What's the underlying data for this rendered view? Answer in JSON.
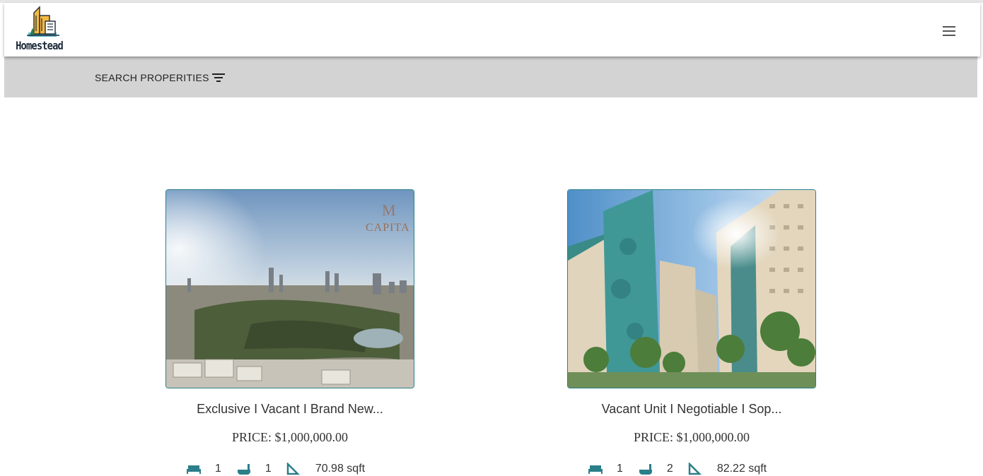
{
  "brand": {
    "name": "Homestead"
  },
  "header": {
    "menu_icon": "hamburger-icon"
  },
  "search": {
    "label": "SEARCH PROPERITIES",
    "icon": "filter-icon"
  },
  "colors": {
    "accent": "#2b7f8a",
    "searchbar_bg": "#d3d3d3"
  },
  "listings": [
    {
      "title": "Exclusive I Vacant I Brand New...",
      "price": "PRICE: $1,000,000.00",
      "beds": "1",
      "baths": "1",
      "area": "70.98 sqft",
      "watermark": "CAPITA"
    },
    {
      "title": "Vacant Unit I Negotiable I Sop...",
      "price": "PRICE: $1,000,000.00",
      "beds": "1",
      "baths": "2",
      "area": "82.22 sqft"
    }
  ]
}
